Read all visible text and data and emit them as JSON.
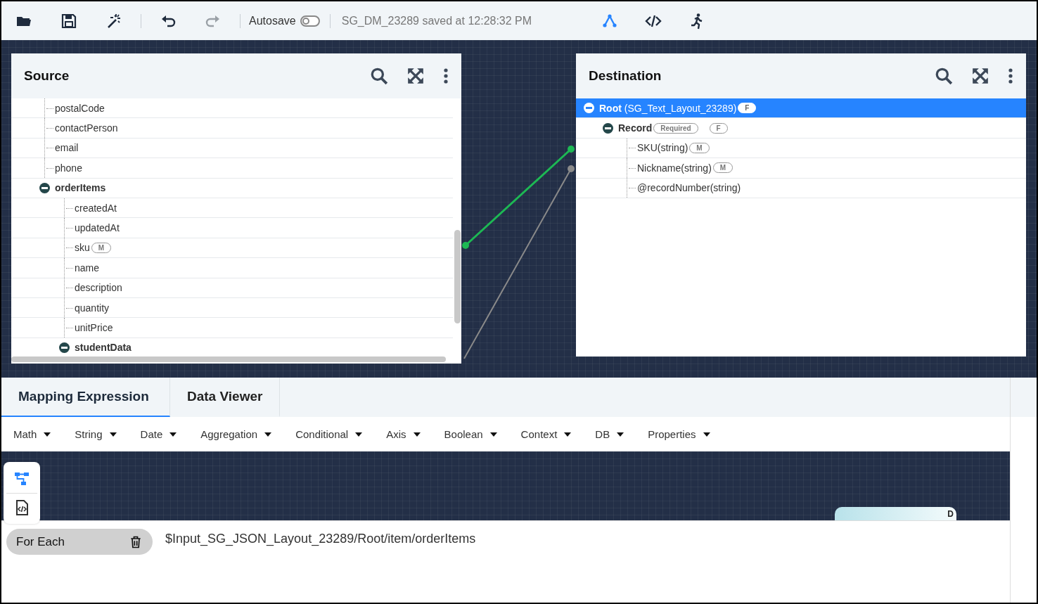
{
  "toolbar": {
    "tools": [
      {
        "kind": "open",
        "disabled": false
      },
      {
        "kind": "save",
        "disabled": false
      },
      {
        "kind": "wand",
        "disabled": false
      },
      {
        "kind": "undo",
        "disabled": false
      },
      {
        "kind": "redo",
        "disabled": true
      }
    ],
    "autosave": {
      "label": "Autosave",
      "on": false
    },
    "status": "SG_DM_23289 saved at 12:28:32 PM",
    "views": [
      {
        "kind": "mapping",
        "selected": true
      },
      {
        "kind": "code",
        "selected": false
      },
      {
        "kind": "run",
        "selected": false
      }
    ]
  },
  "source": {
    "title": "Source",
    "tree": [
      {
        "label": "postalCode",
        "kind": "leaf",
        "selected": false
      },
      {
        "label": "contactPerson",
        "kind": "leaf",
        "selected": false
      },
      {
        "label": "email",
        "kind": "leaf",
        "selected": false
      },
      {
        "label": "phone",
        "kind": "leaf",
        "selected": false
      },
      {
        "label": "orderItems",
        "kind": "group",
        "expanded": true,
        "selected": false,
        "children": [
          {
            "label": "createdAt",
            "kind": "leaf",
            "selected": false
          },
          {
            "label": "updatedAt",
            "kind": "leaf",
            "selected": false
          },
          {
            "label": "sku",
            "kind": "leaf",
            "selected": false,
            "badges": [
              "M"
            ]
          },
          {
            "label": "name",
            "kind": "leaf",
            "selected": false
          },
          {
            "label": "description",
            "kind": "leaf",
            "selected": false
          },
          {
            "label": "quantity",
            "kind": "leaf",
            "selected": false
          },
          {
            "label": "unitPrice",
            "kind": "leaf",
            "selected": false
          },
          {
            "label": "studentData",
            "kind": "group",
            "expanded": true,
            "selected": false
          }
        ]
      }
    ]
  },
  "destination": {
    "title": "Destination",
    "tree": [
      {
        "label": "**Root** (SG_Text_Layout_23289)",
        "kind": "root",
        "expanded": true,
        "selected": true,
        "badges": [
          "F"
        ],
        "children": [
          {
            "label": "Record",
            "kind": "group",
            "expanded": true,
            "selected": false,
            "badges": [
              "Required",
              "F"
            ],
            "children": [
              {
                "label": "SKU(string)",
                "kind": "leaf",
                "selected": false,
                "badges": [
                  "M"
                ]
              },
              {
                "label": "Nickname(string)",
                "kind": "leaf",
                "selected": false,
                "badges": [
                  "M"
                ]
              },
              {
                "label": "@recordNumber(string)",
                "kind": "leaf",
                "selected": false
              }
            ]
          }
        ]
      }
    ]
  },
  "bottom": {
    "tabs": [
      {
        "label": "Mapping Expression",
        "selected": true
      },
      {
        "label": "Data Viewer",
        "selected": false
      }
    ],
    "functions": [
      "Math",
      "String",
      "Date",
      "Aggregation",
      "Conditional",
      "Axis",
      "Boolean",
      "Context",
      "DB",
      "Properties"
    ],
    "tools": [
      {
        "kind": "tree",
        "selected": true
      },
      {
        "kind": "code",
        "selected": false
      }
    ],
    "node": {
      "label": "D"
    },
    "expression": {
      "function": "For Each",
      "path": "$Input_SG_JSON_Layout_23289/Root/item/orderItems"
    }
  }
}
